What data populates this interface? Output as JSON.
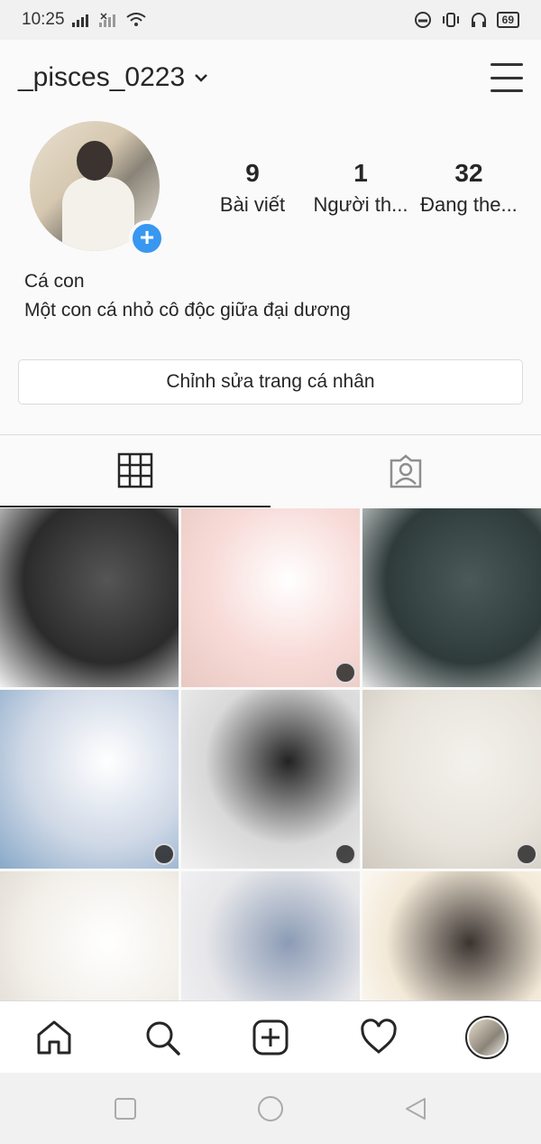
{
  "status_bar": {
    "time": "10:25",
    "battery": "69"
  },
  "header": {
    "username": "_pisces_0223"
  },
  "profile": {
    "stats": [
      {
        "value": "9",
        "label": "Bài viết"
      },
      {
        "value": "1",
        "label": "Người th..."
      },
      {
        "value": "32",
        "label": "Đang the..."
      }
    ],
    "name": "Cá con",
    "bio": "Một con cá nhỏ cô độc giữa đại dương",
    "edit_button": "Chỉnh sửa trang cá nhân"
  },
  "tabs": [
    {
      "icon": "grid-icon",
      "active": true
    },
    {
      "icon": "tagged-icon",
      "active": false
    }
  ],
  "posts": [
    {
      "colors": [
        "#2b2b2b",
        "#555",
        "#f2f2f2"
      ],
      "multi": false
    },
    {
      "colors": [
        "#f7d9d6",
        "#fff",
        "#e8c9c2"
      ],
      "multi": true
    },
    {
      "colors": [
        "#2e3b3a",
        "#4a5a58",
        "#e9e9e9"
      ],
      "multi": false
    },
    {
      "colors": [
        "#cfd8e6",
        "#ffffff",
        "#88a9c8"
      ],
      "multi": true
    },
    {
      "colors": [
        "#d9d9d9",
        "#222",
        "#f1f1f1"
      ],
      "multi": true
    },
    {
      "colors": [
        "#e8e4dc",
        "#f3f1ec",
        "#cfc9bf"
      ],
      "multi": true
    },
    {
      "colors": [
        "#f2efe9",
        "#ffffff",
        "#dcd6cc"
      ],
      "multi": false
    },
    {
      "colors": [
        "#e7e7ea",
        "#8b9bb5",
        "#f5f5f7"
      ],
      "multi": false
    },
    {
      "colors": [
        "#f3e9d8",
        "#3a3330",
        "#ffffff"
      ],
      "multi": false
    }
  ],
  "bottom_nav": [
    "home-icon",
    "search-icon",
    "add-post-icon",
    "activity-icon",
    "profile-avatar"
  ],
  "system_nav": [
    "recents-icon",
    "home-circle-icon",
    "back-icon"
  ]
}
